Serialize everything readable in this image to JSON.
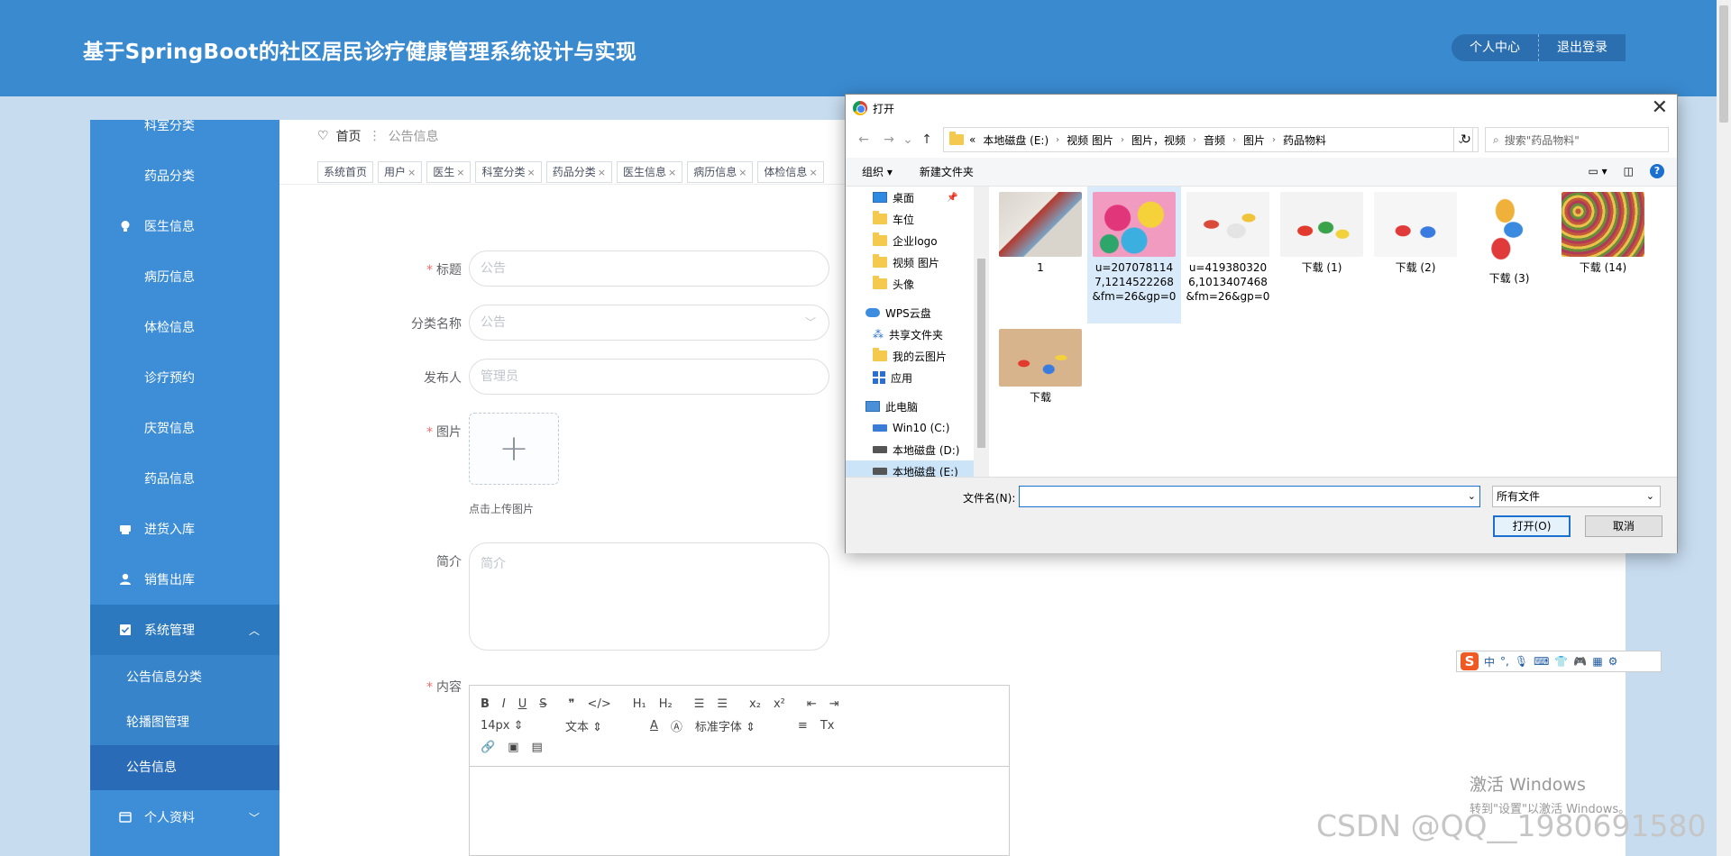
{
  "app": {
    "title": "基于SpringBoot的社区居民诊疗健康管理系统设计与实现",
    "personal_center": "个人中心",
    "logout": "退出登录"
  },
  "sidebar": {
    "items": [
      {
        "label": "科室分类"
      },
      {
        "label": "药品分类"
      },
      {
        "label": "医生信息"
      },
      {
        "label": "病历信息"
      },
      {
        "label": "体检信息"
      },
      {
        "label": "诊疗预约"
      },
      {
        "label": "庆贺信息"
      },
      {
        "label": "药品信息"
      },
      {
        "label": "进货入库"
      },
      {
        "label": "销售出库"
      },
      {
        "label": "系统管理"
      },
      {
        "label": "个人资料"
      }
    ],
    "sub_items": [
      {
        "label": "公告信息分类"
      },
      {
        "label": "轮播图管理"
      },
      {
        "label": "公告信息"
      }
    ]
  },
  "breadcrumb": {
    "home": "首页",
    "current": "公告信息"
  },
  "tags": [
    "系统首页",
    "用户",
    "医生",
    "科室分类",
    "药品分类",
    "医生信息",
    "病历信息",
    "体检信息"
  ],
  "form": {
    "title_label": "标题",
    "title_placeholder": "公告",
    "category_label": "分类名称",
    "category_placeholder": "公告",
    "publisher_label": "发布人",
    "publisher_placeholder": "管理员",
    "image_label": "图片",
    "upload_tip": "点击上传图片",
    "intro_label": "简介",
    "intro_placeholder": "简介",
    "content_label": "内容"
  },
  "editor": {
    "font_size": "14px",
    "text_style": "文本",
    "font_family": "标准字体"
  },
  "dialog": {
    "title": "打开",
    "path": [
      "本地磁盘 (E:)",
      "视频 图片",
      "图片，视频",
      "音频",
      "图片",
      "药品物料"
    ],
    "path_prefix": "«",
    "search_placeholder": "搜索\"药品物料\"",
    "organize": "组织",
    "new_folder": "新建文件夹",
    "nav": [
      "桌面",
      "车位",
      "企业logo",
      "视频 图片",
      "头像",
      "WPS云盘",
      "共享文件夹",
      "我的云图片",
      "应用",
      "此电脑",
      "Win10 (C:)",
      "本地磁盘 (D:)",
      "本地磁盘 (E:)"
    ],
    "files": [
      {
        "name": "1"
      },
      {
        "name": "u=2070781147,1214522268&fm=26&gp=0"
      },
      {
        "name": "u=4193803206,1013407468&fm=26&gp=0"
      },
      {
        "name": "下载 (1)"
      },
      {
        "name": "下载 (2)"
      },
      {
        "name": "下载 (3)"
      },
      {
        "name": "下载 (14)"
      },
      {
        "name": "下载"
      }
    ],
    "filename_label": "文件名(N):",
    "filetype": "所有文件",
    "open": "打开(O)",
    "cancel": "取消"
  },
  "ime": {
    "lang": "中"
  },
  "watermark": {
    "activate_l1": "激活 Windows",
    "activate_l2": "转到\"设置\"以激活 Windows。",
    "csdn": "CSDN @QQ__1980691580"
  },
  "colors": {
    "header": "#3a8ad0",
    "sidebar": "#3d8ed6",
    "accent": "#1a6fcf"
  }
}
